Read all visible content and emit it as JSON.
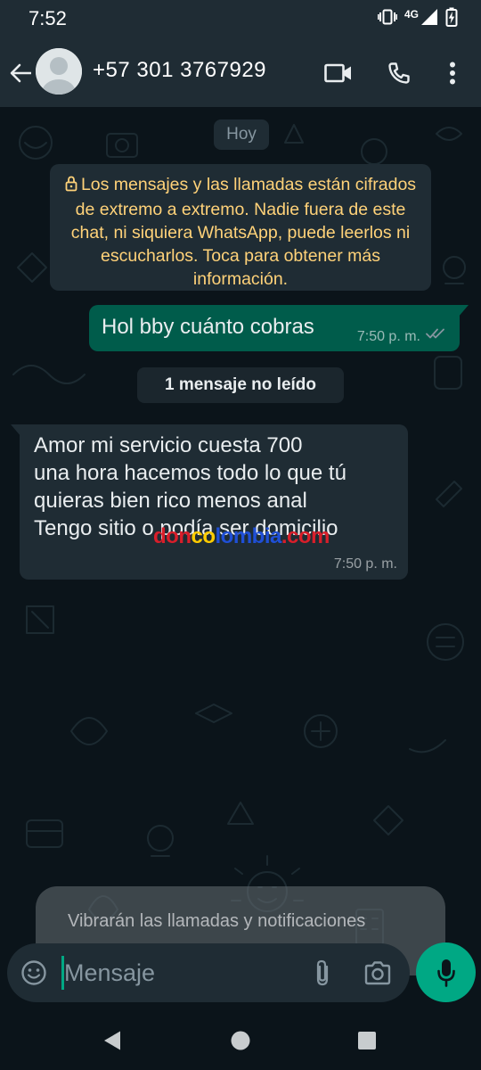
{
  "status_bar": {
    "time": "7:52",
    "network_label": "4G",
    "icons": [
      "vibrate-icon",
      "signal-icon",
      "battery-charging-icon"
    ]
  },
  "header": {
    "contact_name": "+57 301 3767929",
    "icons": [
      "back-arrow-icon",
      "avatar-icon",
      "video-call-icon",
      "phone-icon",
      "more-options-icon"
    ]
  },
  "chat": {
    "date_chip": "Hoy",
    "encryption_notice": "Los mensajes y las llamadas están cifrados de extremo a extremo. Nadie fuera de este chat, ni siquiera WhatsApp, puede leerlos ni escucharlos. Toca para obtener más información.",
    "messages": [
      {
        "direction": "outgoing",
        "text": "Hol bby cuánto cobras",
        "time": "7:50 p. m.",
        "status": "read"
      },
      {
        "direction": "incoming",
        "lines": [
          "Amor mi servicio cuesta 700",
          "una hora hacemos todo lo que tú",
          "quieras bien rico menos anal",
          "Tengo sitio o podía ser domicilio"
        ],
        "time": "7:50 p. m."
      }
    ],
    "unread_banner": "1 mensaje no leído",
    "watermark": {
      "parts": [
        "don",
        "co",
        "lombia",
        ".com"
      ],
      "colors": [
        "#d81e2a",
        "#ffcc00",
        "#1f4fd6",
        "#d81e2a"
      ]
    }
  },
  "toast": {
    "text": "Vibrarán las llamadas y notificaciones"
  },
  "composer": {
    "placeholder": "Mensaje",
    "icons": [
      "emoji-icon",
      "attach-icon",
      "camera-icon",
      "microphone-icon"
    ]
  },
  "nav_bar": {
    "icons": [
      "back-triangle-icon",
      "home-circle-icon",
      "recents-square-icon"
    ]
  },
  "colors": {
    "background": "#0b141a",
    "header": "#1f2c34",
    "outgoing_bubble": "#005c4b",
    "incoming_bubble": "#1f2c34",
    "accent": "#00a884",
    "notice_text": "#ffd279",
    "read_ticks": "#8696a0"
  }
}
